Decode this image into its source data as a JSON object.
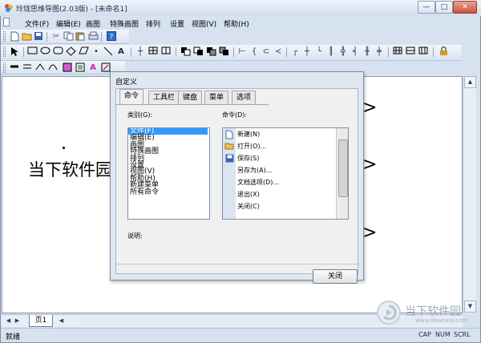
{
  "window": {
    "title": "玲珑思维导图(2.03版) - [未命名1]",
    "controls": {
      "minimize": "—",
      "maximize": "□",
      "close": "✕"
    }
  },
  "menubar": {
    "items": [
      "文件(F)",
      "编辑(E)",
      "画图",
      "特殊画图",
      "排列",
      "设置",
      "视图(V)",
      "帮助(H)"
    ]
  },
  "toolbars": {
    "standard": [
      "new-icon",
      "open-icon",
      "save-icon",
      "cut-icon",
      "copy-icon",
      "paste-icon",
      "help-icon"
    ],
    "draw": [
      "pointer-icon",
      "rect-icon",
      "ellipse-icon",
      "rounded-rect-icon",
      "diamond-icon",
      "parallelogram-icon",
      "point-icon",
      "line-icon",
      "text-icon",
      "cross-icon",
      "table-icon"
    ],
    "line": [
      "thick-line-icon",
      "double-line-icon",
      "polyline-icon",
      "curve-icon",
      "fill-color-icon",
      "font-color-icon",
      "line-color-icon"
    ]
  },
  "canvas": {
    "text": "当下软件园",
    "chevrons": [
      ">",
      ">",
      ">"
    ]
  },
  "tabbar": {
    "page_tab": "页1"
  },
  "statusbar": {
    "text": "就绪",
    "indicators": [
      "CAP",
      "NUM",
      "SCRL"
    ]
  },
  "watermark": {
    "name": "当下软件园",
    "url": "www.downxia.com"
  },
  "dialog": {
    "title": "自定义",
    "tabs": [
      "命令",
      "工具栏",
      "键盘",
      "菜单",
      "选项"
    ],
    "active_tab": "命令",
    "category_label": "类别(G):",
    "categories": [
      "文件(F)",
      "编辑(E)",
      "画图",
      "特殊画图",
      "排列",
      "设置",
      "视图(V)",
      "帮助(H)",
      "新建菜单",
      "所有命令"
    ],
    "selected_category": "文件(F)",
    "command_label": "命令(D):",
    "commands": [
      {
        "label": "新建(N)",
        "icon": "new-doc-icon"
      },
      {
        "label": "打开(O)...",
        "icon": "open-folder-icon"
      },
      {
        "label": "保存(S)",
        "icon": "save-disk-icon"
      },
      {
        "label": "另存为(A)...",
        "icon": ""
      },
      {
        "label": "文档选项(D)...",
        "icon": ""
      },
      {
        "label": "退出(X)",
        "icon": ""
      },
      {
        "label": "关闭(C)",
        "icon": ""
      }
    ],
    "description_label": "说明:",
    "close_button": "关闭"
  }
}
